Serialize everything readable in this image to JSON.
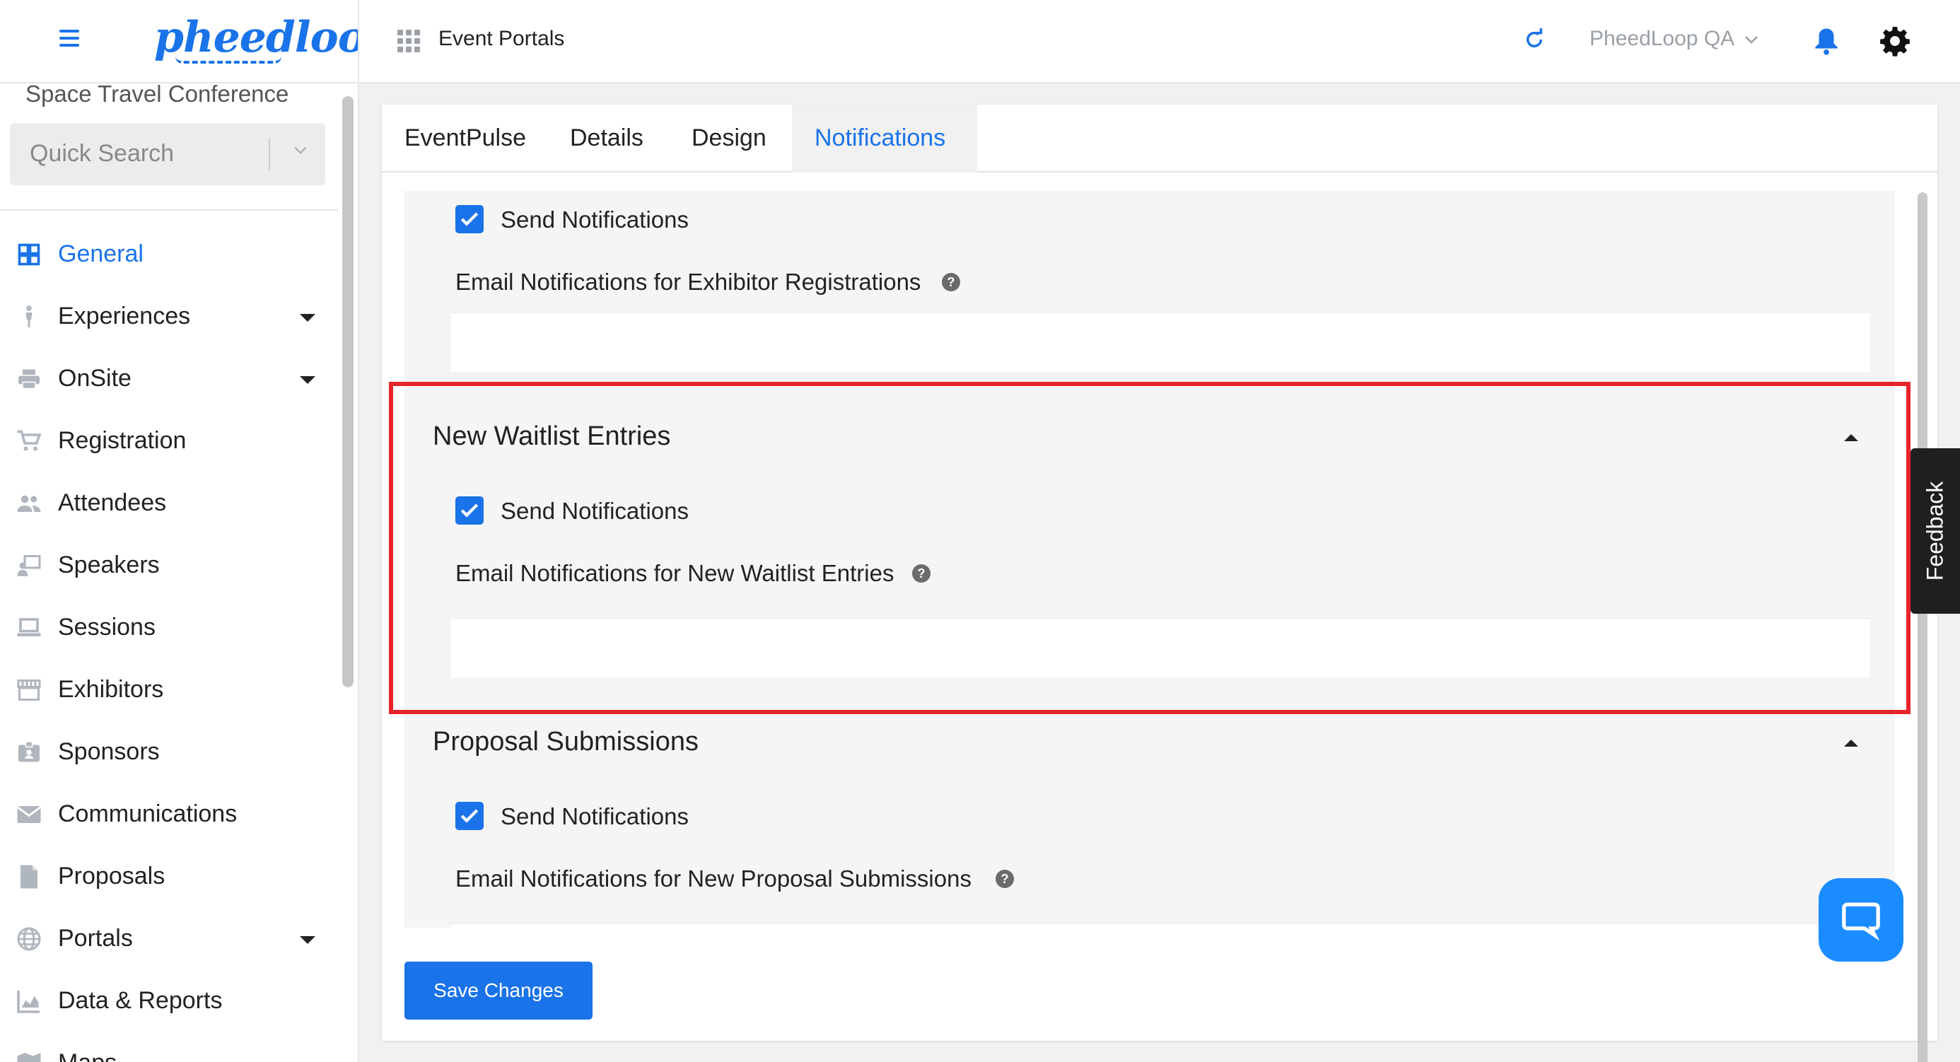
{
  "brand": {
    "logo_text": "pheedloop",
    "accent": "#1a73e8"
  },
  "sidebar": {
    "event_name": "Space Travel Conference",
    "quick_search": {
      "placeholder": "Quick Search"
    },
    "items": [
      {
        "label": "General",
        "icon": "grid-icon",
        "active": true,
        "has_caret": false
      },
      {
        "label": "Experiences",
        "icon": "person-icon",
        "active": false,
        "has_caret": true
      },
      {
        "label": "OnSite",
        "icon": "printer-icon",
        "active": false,
        "has_caret": true
      },
      {
        "label": "Registration",
        "icon": "cart-icon",
        "active": false,
        "has_caret": false
      },
      {
        "label": "Attendees",
        "icon": "people-icon",
        "active": false,
        "has_caret": false
      },
      {
        "label": "Speakers",
        "icon": "speaker-icon",
        "active": false,
        "has_caret": false
      },
      {
        "label": "Sessions",
        "icon": "laptop-icon",
        "active": false,
        "has_caret": false
      },
      {
        "label": "Exhibitors",
        "icon": "store-icon",
        "active": false,
        "has_caret": false
      },
      {
        "label": "Sponsors",
        "icon": "badge-icon",
        "active": false,
        "has_caret": false
      },
      {
        "label": "Communications",
        "icon": "mail-icon",
        "active": false,
        "has_caret": false
      },
      {
        "label": "Proposals",
        "icon": "file-icon",
        "active": false,
        "has_caret": false
      },
      {
        "label": "Portals",
        "icon": "globe-icon",
        "active": false,
        "has_caret": true
      },
      {
        "label": "Data & Reports",
        "icon": "chart-icon",
        "active": false,
        "has_caret": false
      },
      {
        "label": "Maps",
        "icon": "map-icon",
        "active": false,
        "has_caret": false
      }
    ]
  },
  "header": {
    "title": "Event Portals",
    "org_name": "PheedLoop QA"
  },
  "tabs": [
    {
      "label": "EventPulse",
      "active": false
    },
    {
      "label": "Details",
      "active": false
    },
    {
      "label": "Design",
      "active": false
    },
    {
      "label": "Notifications",
      "active": true
    }
  ],
  "sections": {
    "exhibitor": {
      "send_label": "Send Notifications",
      "email_label": "Email Notifications for Exhibitor Registrations",
      "email_value": ""
    },
    "waitlist": {
      "title": "New Waitlist Entries",
      "send_label": "Send Notifications",
      "email_label": "Email Notifications for New Waitlist Entries",
      "email_value": ""
    },
    "proposal": {
      "title": "Proposal Submissions",
      "send_label": "Send Notifications",
      "email_label": "Email Notifications for New Proposal Submissions",
      "email_value": ""
    }
  },
  "help_glyph": "?",
  "save_button": "Save Changes",
  "feedback_label": "Feedback",
  "colors": {
    "highlight": "#e8232a",
    "chat": "#1a8cff"
  }
}
